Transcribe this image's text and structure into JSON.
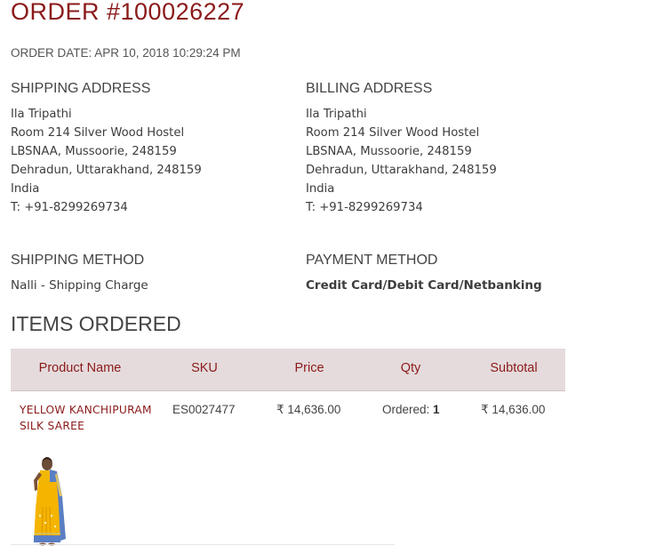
{
  "order": {
    "title": "ORDER #100026227",
    "date": "ORDER DATE: APR 10, 2018 10:29:24 PM"
  },
  "shipping_address": {
    "heading": "SHIPPING ADDRESS",
    "lines": [
      "Ila Tripathi",
      "Room 214 Silver Wood Hostel",
      "LBSNAA, Mussoorie, 248159",
      "Dehradun, Uttarakhand, 248159",
      "India",
      "T: +91-8299269734"
    ]
  },
  "billing_address": {
    "heading": "BILLING ADDRESS",
    "lines": [
      "Ila Tripathi",
      "Room 214 Silver Wood Hostel",
      "LBSNAA, Mussoorie, 248159",
      "Dehradun, Uttarakhand, 248159",
      "India",
      "T: +91-8299269734"
    ]
  },
  "shipping_method": {
    "heading": "SHIPPING METHOD",
    "value": "Nalli - Shipping Charge"
  },
  "payment_method": {
    "heading": "PAYMENT METHOD",
    "value": "Credit Card/Debit Card/Netbanking"
  },
  "items": {
    "heading": "ITEMS ORDERED",
    "columns": [
      "Product Name",
      "SKU",
      "Price",
      "Qty",
      "Subtotal"
    ],
    "rows": [
      {
        "name": "Yellow Kanchipuram Silk Saree",
        "sku": "ES0027477",
        "price": "₹ 14,636.00",
        "qty_label": "Ordered:",
        "qty_value": "1",
        "subtotal": "₹ 14,636.00",
        "thumbnail_icon": "saree-product-image"
      }
    ]
  },
  "colors": {
    "accent": "#8b1a1a",
    "table_header_bg": "#e5dbdc"
  }
}
